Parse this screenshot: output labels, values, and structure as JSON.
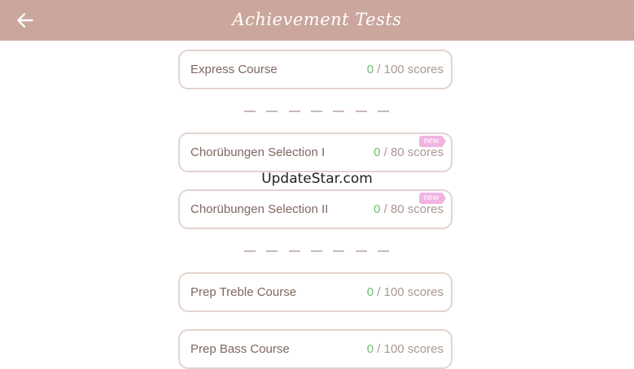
{
  "header": {
    "title": "Achievement Tests",
    "back_icon": "arrow-left-icon"
  },
  "cards": [
    {
      "label": "Express Course",
      "current": "0",
      "total": "/ 100 scores",
      "badge": ""
    },
    {
      "label": "Chorübungen Selection I",
      "current": "0",
      "total": "/ 80 scores",
      "badge": "new"
    },
    {
      "label": "Chorübungen Selection II",
      "current": "0",
      "total": "/ 80 scores",
      "badge": "new"
    },
    {
      "label": "Prep Treble Course",
      "current": "0",
      "total": "/ 100 scores",
      "badge": ""
    },
    {
      "label": "Prep Bass Course",
      "current": "0",
      "total": "/ 100 scores",
      "badge": ""
    }
  ],
  "watermark": "UpdateStar.com",
  "colors": {
    "header_bg": "#caa69c",
    "card_border": "#e3d4cf",
    "score_current": "#6dbf6d",
    "badge_bg": "#f1b4e2"
  }
}
